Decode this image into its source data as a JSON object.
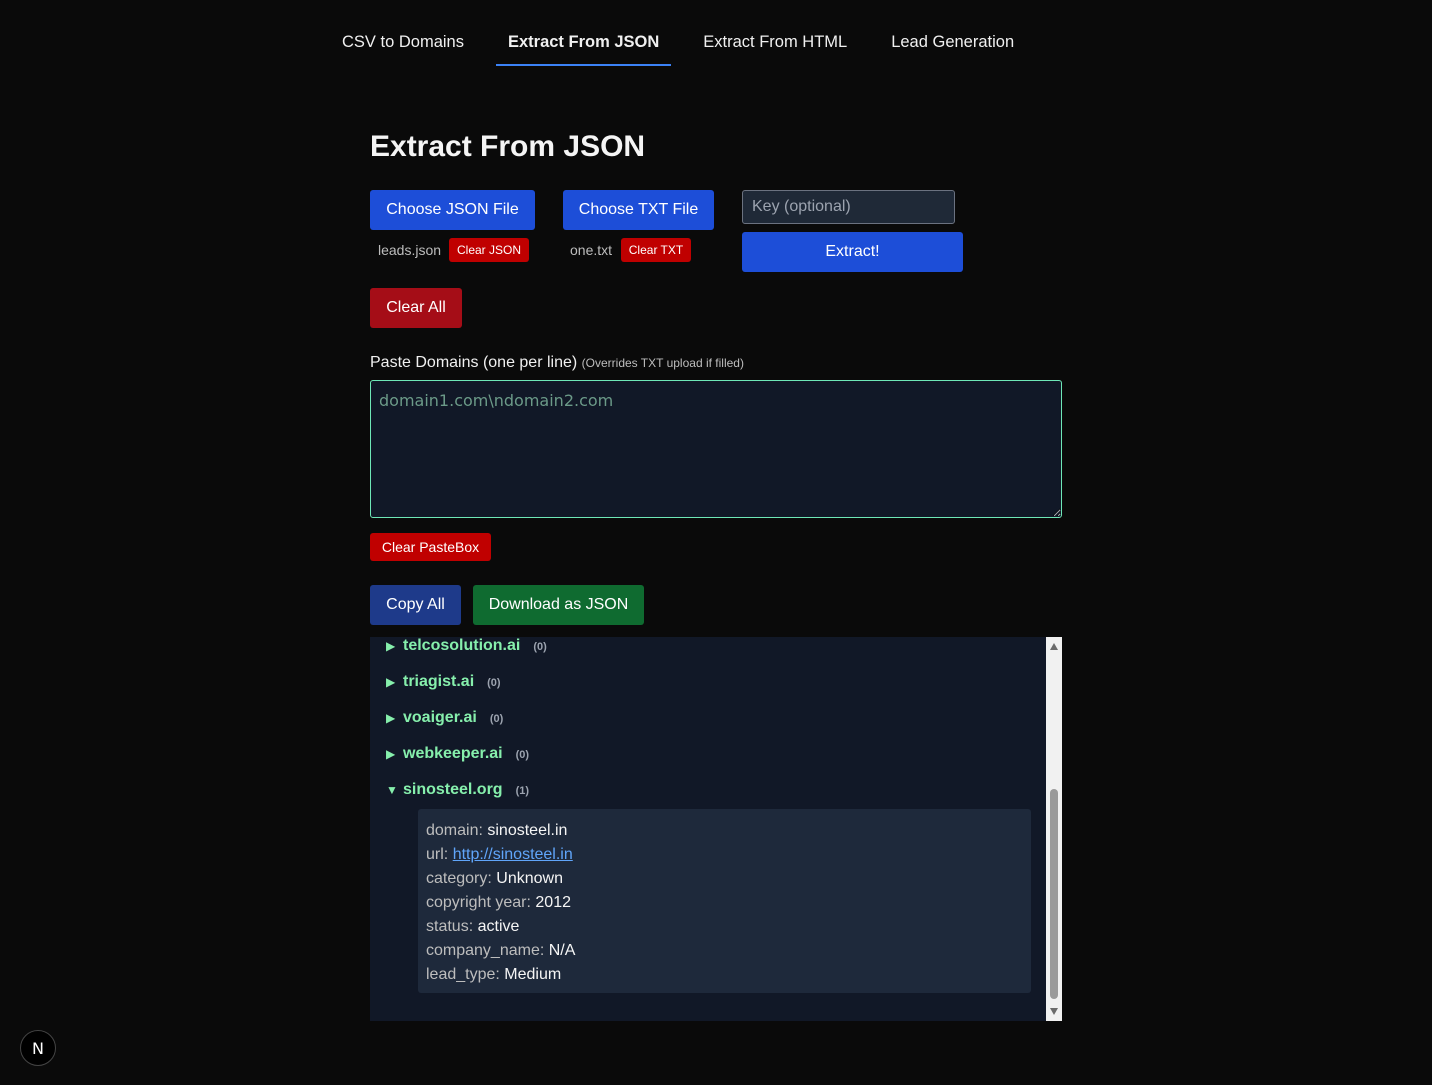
{
  "tabs": [
    {
      "label": "CSV to Domains",
      "active": false
    },
    {
      "label": "Extract From JSON",
      "active": true
    },
    {
      "label": "Extract From HTML",
      "active": false
    },
    {
      "label": "Lead Generation",
      "active": false
    }
  ],
  "page_title": "Extract From JSON",
  "upload": {
    "choose_json_label": "Choose JSON File",
    "choose_txt_label": "Choose TXT File",
    "json_filename": "leads.json",
    "txt_filename": "one.txt",
    "clear_json_label": "Clear JSON",
    "clear_txt_label": "Clear TXT"
  },
  "key_input": {
    "placeholder": "Key (optional)",
    "value": ""
  },
  "extract_label": "Extract!",
  "clear_all_label": "Clear All",
  "paste": {
    "label": "Paste Domains (one per line)",
    "hint": "(Overrides TXT upload if filled)",
    "placeholder": "domain1.com\\ndomain2.com",
    "value": "",
    "clear_label": "Clear PasteBox"
  },
  "actions": {
    "copy_all_label": "Copy All",
    "download_label": "Download as JSON"
  },
  "results": [
    {
      "domain": "telcosolution.ai",
      "count": "(0)",
      "arrow": "▶",
      "expanded": false
    },
    {
      "domain": "triagist.ai",
      "count": "(0)",
      "arrow": "▶",
      "expanded": false
    },
    {
      "domain": "voaiger.ai",
      "count": "(0)",
      "arrow": "▶",
      "expanded": false
    },
    {
      "domain": "webkeeper.ai",
      "count": "(0)",
      "arrow": "▶",
      "expanded": false
    },
    {
      "domain": "sinosteel.org",
      "count": "(1)",
      "arrow": "▼",
      "expanded": true
    }
  ],
  "detail": {
    "domain": {
      "key": "domain:",
      "value": "sinosteel.in"
    },
    "url": {
      "key": "url:",
      "value": "http://sinosteel.in"
    },
    "category": {
      "key": "category:",
      "value": "Unknown"
    },
    "copyright_year": {
      "key": "copyright year:",
      "value": "2012"
    },
    "status": {
      "key": "status:",
      "value": "active"
    },
    "company_name": {
      "key": "company_name:",
      "value": "N/A"
    },
    "lead_type": {
      "key": "lead_type:",
      "value": "Medium"
    }
  },
  "badge": {
    "letter": "N"
  },
  "colors": {
    "accent": "#3b82f6",
    "primary_button": "#1d4ed8",
    "danger": "#c00000",
    "success": "#0f6b30",
    "domain_text": "#86efac"
  }
}
